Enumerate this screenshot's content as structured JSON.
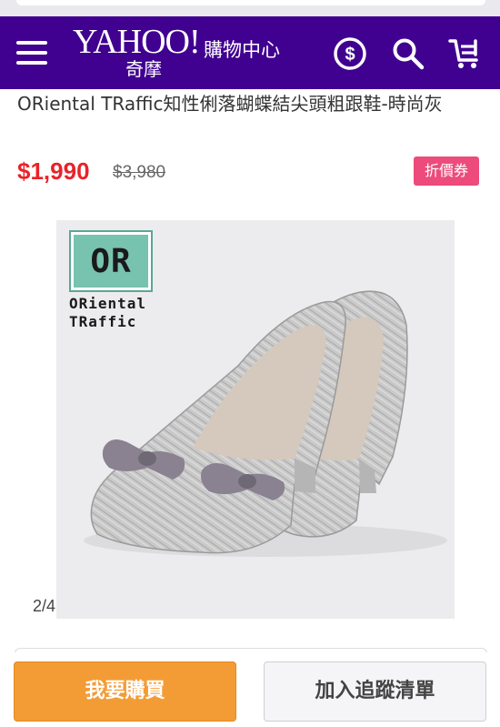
{
  "header": {
    "logo_word": "YAHOO!",
    "logo_sub": "奇摩",
    "section": "購物中心",
    "icons": [
      "menu-icon",
      "dollar-icon",
      "search-icon",
      "cart-icon"
    ],
    "background_color": "#400090"
  },
  "product": {
    "title": "ORiental TRaffic知性俐落蝴蝶結尖頭粗跟鞋-時尚灰",
    "price": "$1,990",
    "original_price": "$3,980",
    "coupon_label": "折價券",
    "image": {
      "brand_logo_text": "OR",
      "brand_name_line1": "ORiental",
      "brand_name_line2": "TRaffic"
    },
    "image_counter": "2/4"
  },
  "actions": {
    "buy_label": "我要購買",
    "track_label": "加入追蹤清單"
  },
  "colors": {
    "price": "#e8232a",
    "coupon": "#ec4b7b",
    "buy_button": "#f39c36"
  }
}
